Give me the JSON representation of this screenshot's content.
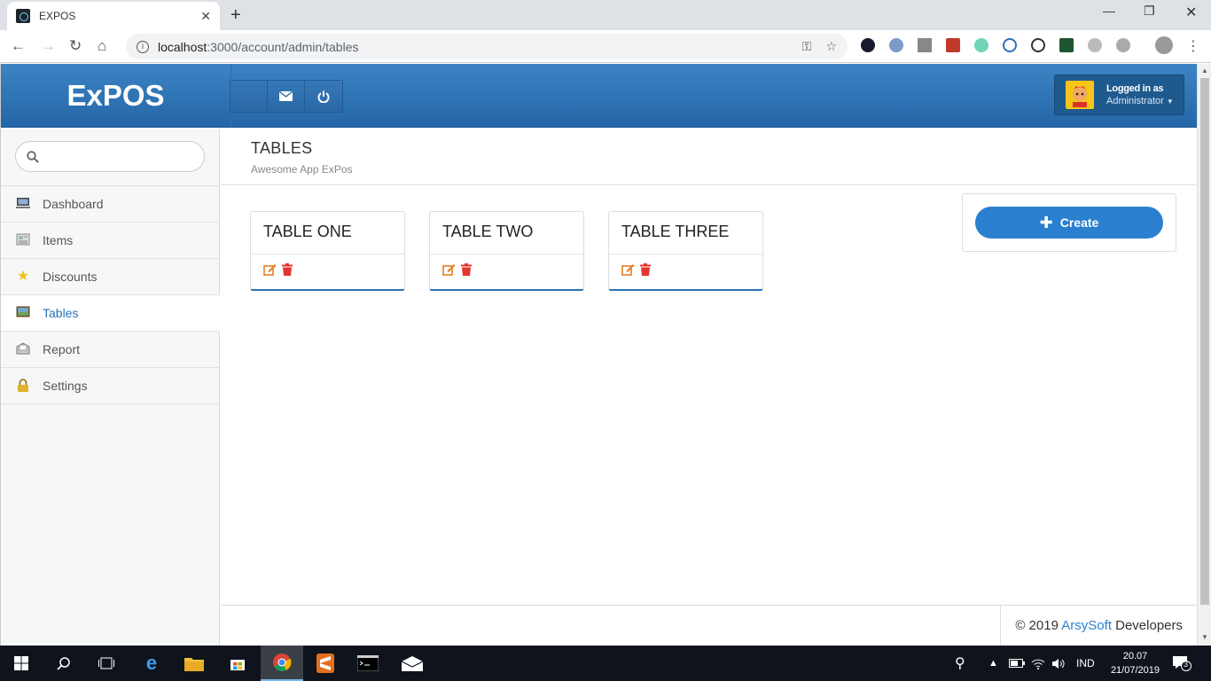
{
  "browser": {
    "tab_title": "EXPOS",
    "url_host": "localhost",
    "url_path": ":3000/account/admin/tables"
  },
  "header": {
    "brand": "ExPOS",
    "user_line1": "Logged in as",
    "user_line2": "Administrator"
  },
  "sidebar": {
    "search_placeholder": "",
    "items": [
      {
        "label": "Dashboard",
        "icon": "monitor-icon"
      },
      {
        "label": "Items",
        "icon": "items-icon"
      },
      {
        "label": "Discounts",
        "icon": "star-icon"
      },
      {
        "label": "Tables",
        "icon": "table-image-icon",
        "active": true
      },
      {
        "label": "Report",
        "icon": "report-icon"
      },
      {
        "label": "Settings",
        "icon": "lock-icon"
      }
    ]
  },
  "page": {
    "title": "TABLES",
    "subtitle": "Awesome App ExPos"
  },
  "tables": [
    {
      "name": "TABLE ONE"
    },
    {
      "name": "TABLE TWO"
    },
    {
      "name": "TABLE THREE"
    }
  ],
  "create_label": "Create",
  "footer": {
    "prefix": "© 2019 ",
    "accent": "ArsySoft",
    "suffix": " Developers"
  },
  "taskbar": {
    "lang": "IND",
    "time": "20.07",
    "date": "21/07/2019",
    "notif_count": "3"
  },
  "colors": {
    "header_blue": "#2a6eae",
    "accent": "#2a80cf",
    "edit_orange": "#e67e22",
    "delete_red": "#e3342f"
  }
}
